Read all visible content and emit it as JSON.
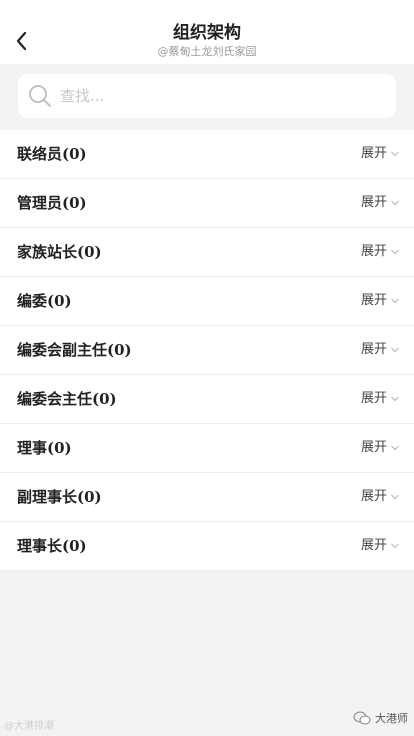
{
  "header": {
    "title": "组织架构",
    "subtitle": "@蔡甸土龙刘氏家园"
  },
  "search": {
    "placeholder": "查找..."
  },
  "list": {
    "items": [
      {
        "label": "联络员(0)",
        "action": "展开"
      },
      {
        "label": "管理员(0)",
        "action": "展开"
      },
      {
        "label": "家族站长(0)",
        "action": "展开"
      },
      {
        "label": "编委(0)",
        "action": "展开"
      },
      {
        "label": "编委会副主任(0)",
        "action": "展开"
      },
      {
        "label": "编委会主任(0)",
        "action": "展开"
      },
      {
        "label": "理事(0)",
        "action": "展开"
      },
      {
        "label": "副理事长(0)",
        "action": "展开"
      },
      {
        "label": "理事长(0)",
        "action": "展开"
      }
    ]
  },
  "watermark": {
    "left": "@大港排潮",
    "right": "大港师"
  },
  "colors": {
    "background": "#f3f3f5",
    "card": "#ffffff",
    "divider": "#ececec",
    "placeholder": "#c7c7c7"
  },
  "icons": {
    "back": "chevron-left-icon",
    "search": "search-icon",
    "expand": "chevron-down-icon"
  }
}
